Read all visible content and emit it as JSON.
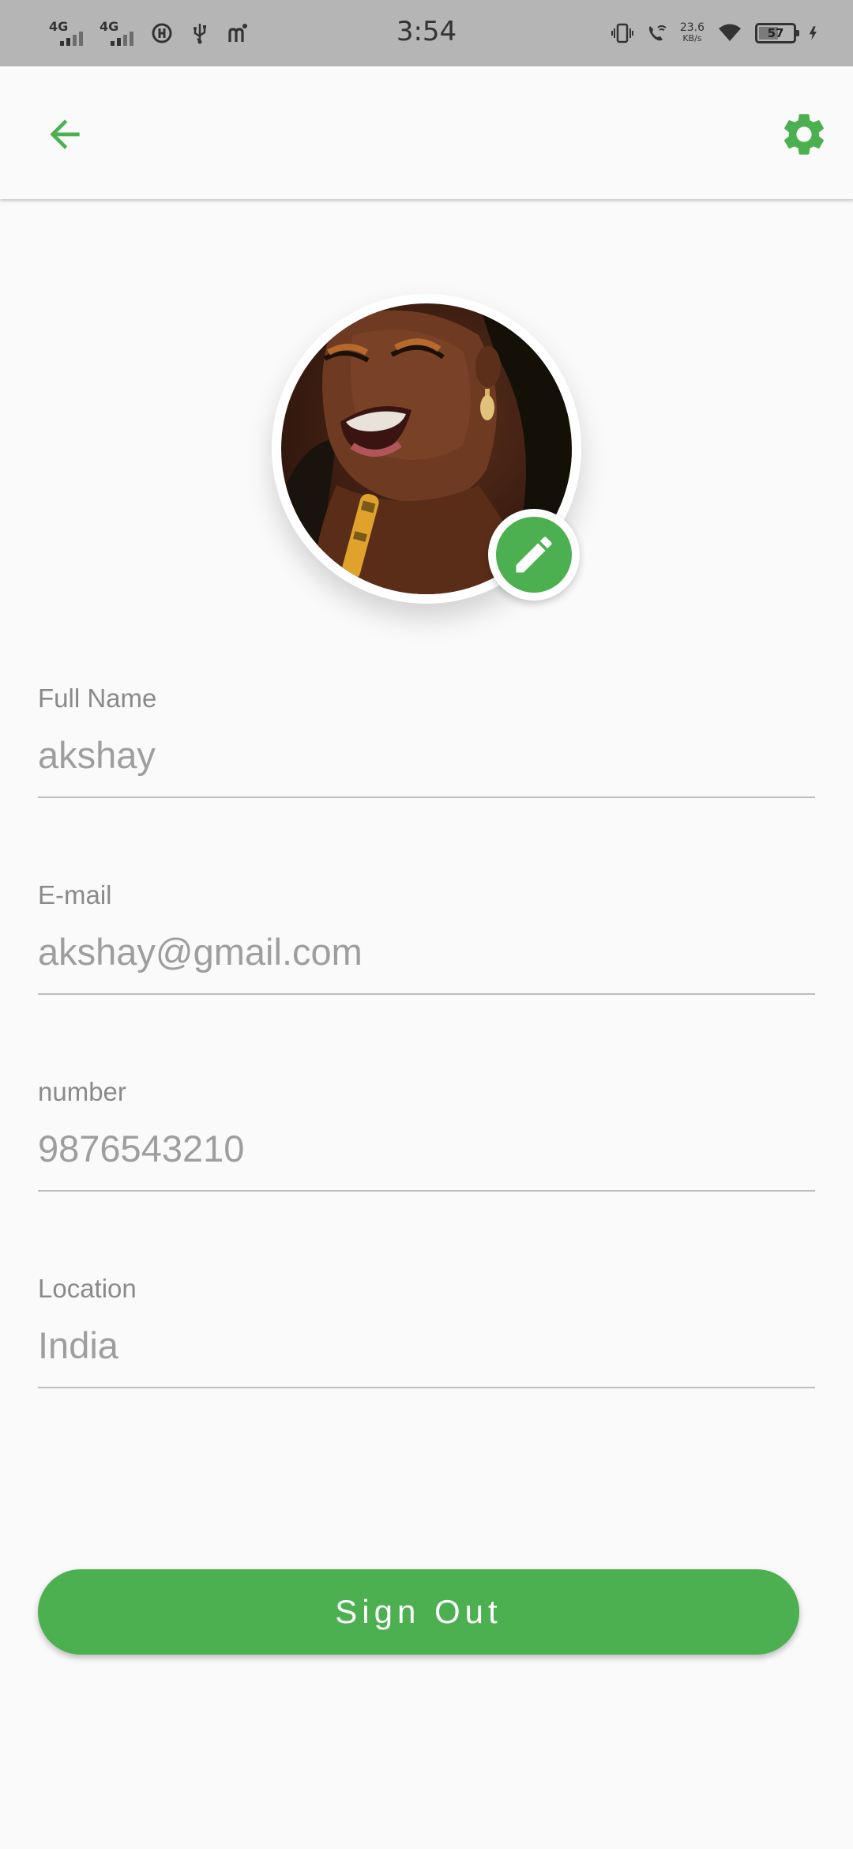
{
  "status_bar": {
    "time": "3:54",
    "signal_1": "4G",
    "signal_2": "4G",
    "net_speed_value": "23.6",
    "net_speed_unit": "KB/s",
    "battery_level": "57"
  },
  "app_bar": {
    "back_icon": "arrow-back-icon",
    "settings_icon": "gear-icon"
  },
  "profile": {
    "avatar": "profile-photo",
    "edit_icon": "pencil-icon"
  },
  "fields": [
    {
      "label": "Full Name",
      "value": "akshay"
    },
    {
      "label": "E-mail",
      "value": "akshay@gmail.com"
    },
    {
      "label": "number",
      "value": "9876543210"
    },
    {
      "label": "Location",
      "value": "India"
    }
  ],
  "sign_out_label": "Sign Out",
  "colors": {
    "accent": "#4caf50",
    "background": "#fafafa",
    "status_bar": "#b5b5b5",
    "label": "#8a8a8a",
    "value": "#9e9e9e"
  }
}
